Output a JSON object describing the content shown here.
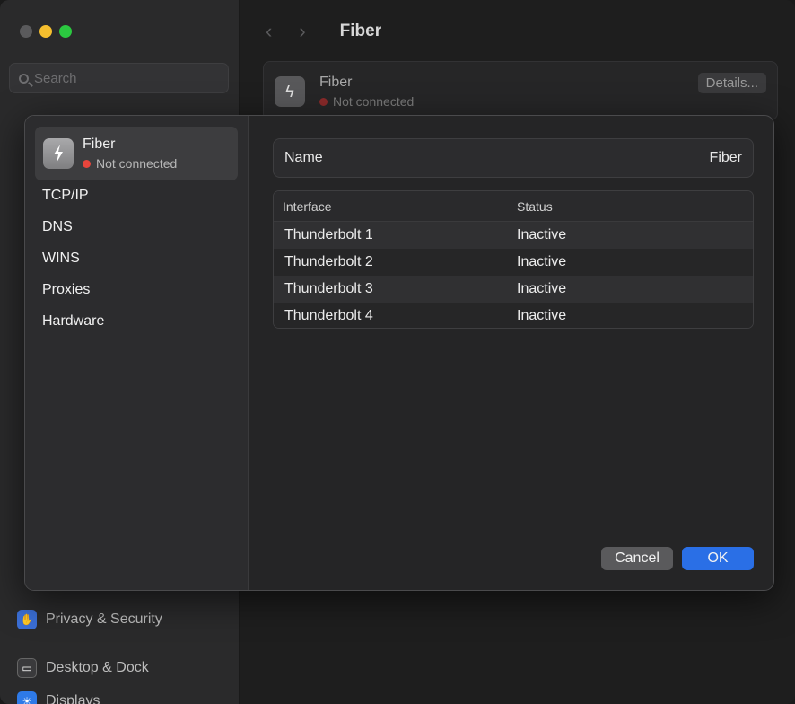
{
  "background": {
    "search_placeholder": "Search",
    "toolbar_title": "Fiber",
    "sidebar_items": [
      {
        "label": "Privacy & Security",
        "icon": "hand-icon"
      },
      {
        "label": "Desktop & Dock",
        "icon": "dock-icon"
      },
      {
        "label": "Displays",
        "icon": "sun-icon"
      }
    ],
    "card": {
      "name": "Fiber",
      "status": "Not connected",
      "details_label": "Details..."
    }
  },
  "sheet": {
    "sidebar": {
      "selected": {
        "name": "Fiber",
        "status": "Not connected"
      },
      "items": [
        "TCP/IP",
        "DNS",
        "WINS",
        "Proxies",
        "Hardware"
      ]
    },
    "name_field": {
      "label": "Name",
      "value": "Fiber"
    },
    "table": {
      "headers": [
        "Interface",
        "Status"
      ],
      "rows": [
        [
          "Thunderbolt 1",
          "Inactive"
        ],
        [
          "Thunderbolt 2",
          "Inactive"
        ],
        [
          "Thunderbolt 3",
          "Inactive"
        ],
        [
          "Thunderbolt 4",
          "Inactive"
        ]
      ]
    },
    "buttons": {
      "cancel": "Cancel",
      "ok": "OK"
    }
  },
  "colors": {
    "accent": "#2a6fe6",
    "status_disconnected": "#e8453c"
  }
}
